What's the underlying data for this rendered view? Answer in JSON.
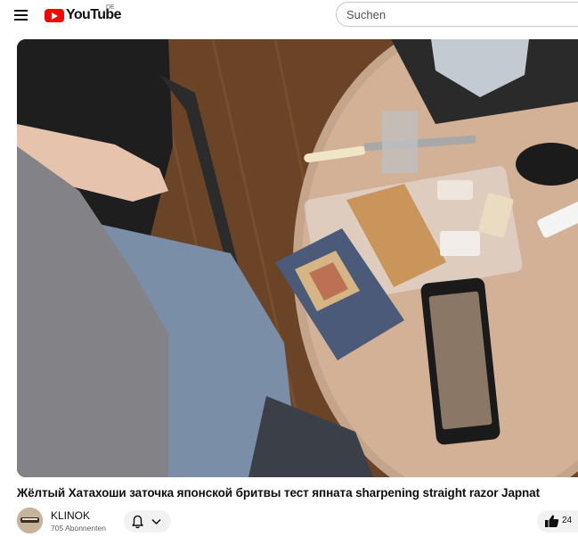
{
  "header": {
    "logo_text": "YouTube",
    "country_code": "DE",
    "search_placeholder": "Suchen"
  },
  "video": {
    "title": "Жёлтый Хатахоши заточка японской бритвы тест япната sharpening straight razor Japnat"
  },
  "channel": {
    "name": "KLINOK",
    "subscribers": "705 Abonnenten"
  },
  "actions": {
    "like_count": "24"
  },
  "icons": {
    "menu": "hamburger-menu-icon",
    "bell": "bell-icon",
    "dropdown": "chevron-down-icon",
    "like": "thumbs-up-icon"
  },
  "colors": {
    "brand": "#ff0000",
    "button_bg": "#f2f2f2",
    "secondary_text": "#606060"
  }
}
